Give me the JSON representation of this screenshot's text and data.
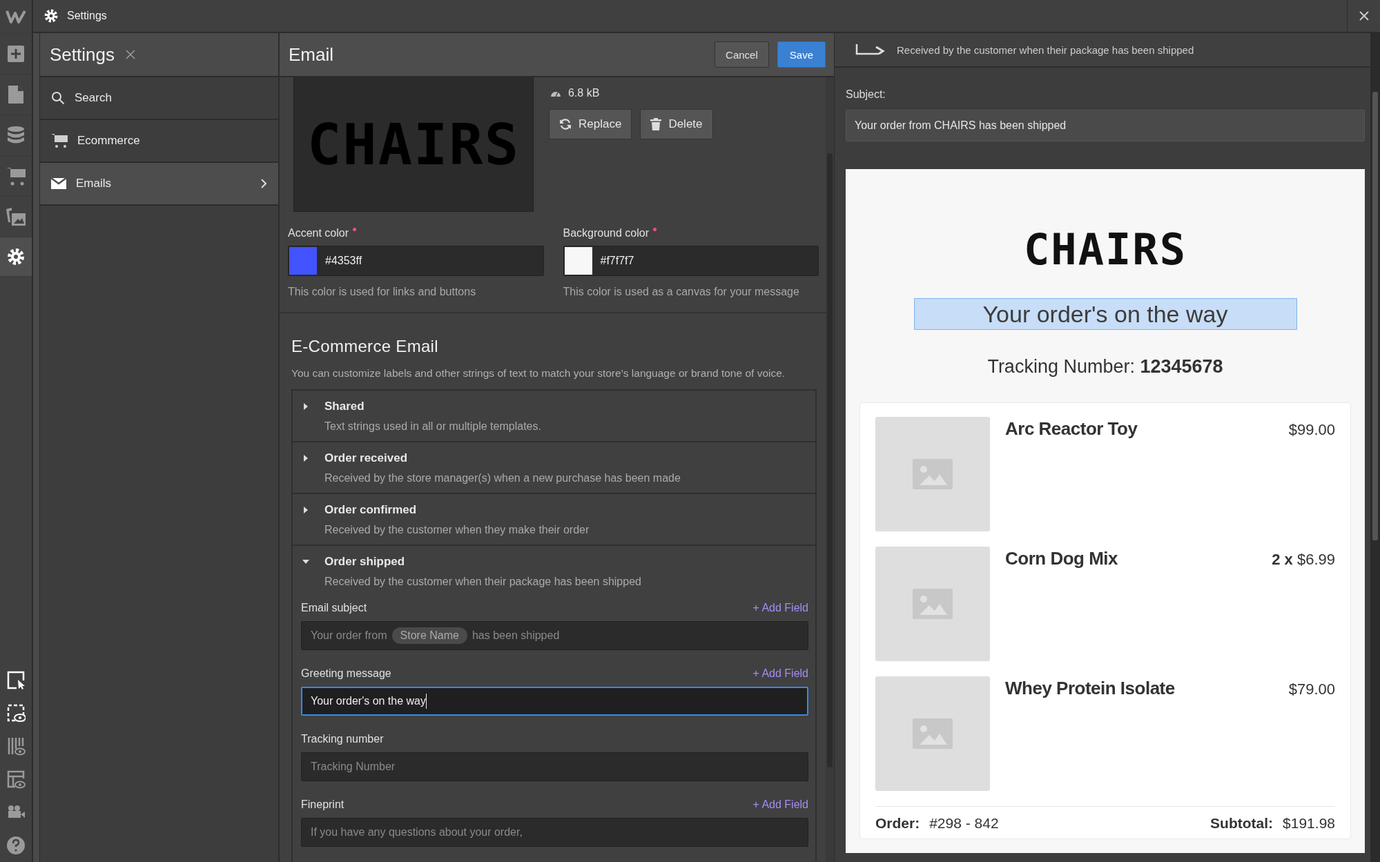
{
  "app_bar": {
    "title": "Settings"
  },
  "toolbar": {
    "top": [
      {
        "kind": "logo",
        "selected": false
      },
      {
        "kind": "add",
        "selected": false
      },
      {
        "kind": "pages",
        "selected": false
      },
      {
        "kind": "cms",
        "selected": false
      },
      {
        "kind": "ecommerce",
        "selected": false
      },
      {
        "kind": "assets",
        "selected": false
      },
      {
        "kind": "settings",
        "selected": true
      }
    ],
    "bottom": [
      {
        "kind": "select",
        "on": true
      },
      {
        "kind": "guides",
        "on": true
      },
      {
        "kind": "grid",
        "on": false
      },
      {
        "kind": "layout",
        "on": false
      },
      {
        "kind": "video",
        "on": false
      },
      {
        "kind": "help",
        "on": false
      }
    ]
  },
  "settings_panel": {
    "title": "Settings",
    "items": [
      {
        "kind": "search",
        "label": "Search",
        "selected": false
      },
      {
        "kind": "ecommerce",
        "label": "Ecommerce",
        "selected": false
      },
      {
        "kind": "emails",
        "label": "Emails",
        "selected": true
      }
    ]
  },
  "email_panel": {
    "title": "Email",
    "buttons": [
      {
        "kind": "cancel",
        "label": "Cancel"
      },
      {
        "kind": "save",
        "label": "Save"
      }
    ],
    "logo": {
      "text": "CHAIRS",
      "file_size": "6.8 kB"
    },
    "image_buttons": [
      {
        "kind": "replace",
        "label": "Replace"
      },
      {
        "kind": "delete",
        "label": "Delete"
      }
    ],
    "colors": [
      {
        "label": "Accent color",
        "required": true,
        "value": "#4353ff",
        "color": "#4353ff",
        "hint": "This color is used for links and buttons"
      },
      {
        "label": "Background color",
        "required": true,
        "value": "#f7f7f7",
        "color": "#f7f7f7",
        "hint": "This color is used as a canvas for your message"
      }
    ],
    "section": {
      "title": "E-Commerce Email",
      "description": "You can customize labels and other strings of text to match your store’s language or brand tone of voice.",
      "templates": [
        {
          "title": "Shared",
          "description": "Text strings used in all or multiple templates.",
          "expanded": false
        },
        {
          "title": "Order received",
          "description": "Received by the store manager(s) when a new purchase has been made",
          "expanded": false
        },
        {
          "title": "Order confirmed",
          "description": "Received by the customer when they make their order",
          "expanded": false
        },
        {
          "title": "Order shipped",
          "description": "Received by the customer when their package has been shipped",
          "expanded": true
        }
      ],
      "fields": [
        {
          "label": "Email subject",
          "add_field": "+ Add Field",
          "focused": false,
          "parts": [
            {
              "kind": "text",
              "text": "Your order from"
            },
            {
              "kind": "token",
              "text": "Store Name"
            },
            {
              "kind": "text",
              "text": "has been shipped"
            }
          ]
        },
        {
          "label": "Greeting message",
          "add_field": "+ Add Field",
          "focused": true,
          "value": "Your order's on the way"
        },
        {
          "label": "Tracking number",
          "focused": false,
          "placeholder": "Tracking Number"
        },
        {
          "label": "Fineprint",
          "add_field": "+ Add Field",
          "focused": false,
          "placeholder": "If you have any questions about your order,"
        }
      ]
    }
  },
  "preview": {
    "template_description": "Received by the customer when their package has been shipped",
    "subject_label": "Subject:",
    "subject": "Your order from CHAIRS has been shipped",
    "email": {
      "logo": "CHAIRS",
      "greeting": "Your order's on the way",
      "greeting_highlighted": true,
      "tracking": "Tracking Number: **12345678**",
      "items": [
        {
          "name": "Arc Reactor Toy",
          "price": "$99.00"
        },
        {
          "name": "Corn Dog Mix",
          "price": "**2 x** $6.99"
        },
        {
          "name": "Whey Protein Isolate",
          "price": "$79.00"
        }
      ],
      "order_label": "Order:",
      "order_number": "#298 - 842",
      "subtotal_label": "Subtotal:",
      "subtotal": "$191.98"
    }
  }
}
